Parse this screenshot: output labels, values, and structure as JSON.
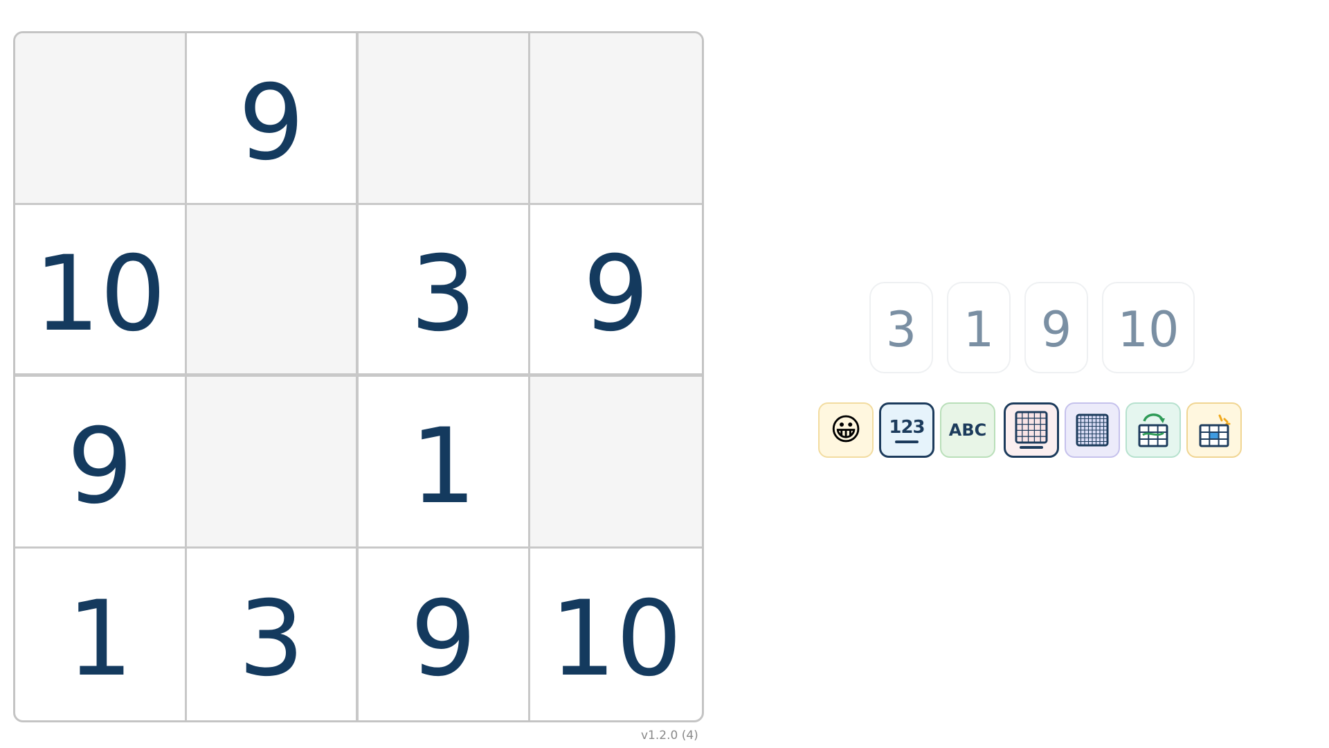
{
  "board": {
    "rows": [
      [
        "",
        "9",
        "",
        ""
      ],
      [
        "10",
        "",
        "3",
        "9"
      ],
      [
        "9",
        "",
        "1",
        ""
      ],
      [
        "1",
        "3",
        "9",
        "10"
      ]
    ]
  },
  "version": "v1.2.0 (4)",
  "chips": [
    "3",
    "1",
    "9",
    "10"
  ],
  "tools": {
    "emoji": {
      "icon": "smiley-face-icon",
      "glyph": "😀"
    },
    "numbers": {
      "label": "123",
      "selected": true
    },
    "letters": {
      "label": "ABC"
    },
    "grid_small": {
      "icon": "small-grid-icon",
      "selected": true
    },
    "grid_large": {
      "icon": "large-grid-icon"
    },
    "shuffle": {
      "icon": "shuffle-grid-icon"
    },
    "hint": {
      "icon": "hint-grid-icon"
    }
  },
  "colors": {
    "digit": "#143a5e",
    "empty_cell": "#f5f5f5",
    "chip_text": "#7a8fa3",
    "accent": "#1c3b5c"
  }
}
